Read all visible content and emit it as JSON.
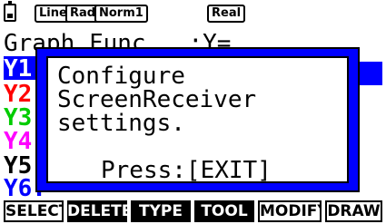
{
  "status_bar": {
    "indicators": [
      "Line",
      "Rad",
      "Norm1",
      "Real"
    ],
    "battery_icon": "battery-icon"
  },
  "graph_list": {
    "title": "Graph Func   :Y=",
    "rows": [
      "Y1",
      "Y2",
      "Y3",
      "Y4",
      "Y5",
      "Y6:"
    ],
    "row_colors": [
      "#0000ff",
      "#ff0000",
      "#00cc00",
      "#ff00ff",
      "#000000",
      "#0000ff"
    ]
  },
  "dialog": {
    "lines": [
      "Configure",
      "ScreenReceiver",
      "settings."
    ],
    "prompt": "Press:[EXIT]"
  },
  "function_keys": [
    "SELECT",
    "DELETE",
    "TYPE",
    "TOOL",
    "MODIFY",
    "DRAW"
  ],
  "colors": {
    "accent": "#0000ff",
    "background": "#ffffff",
    "text": "#000000"
  }
}
